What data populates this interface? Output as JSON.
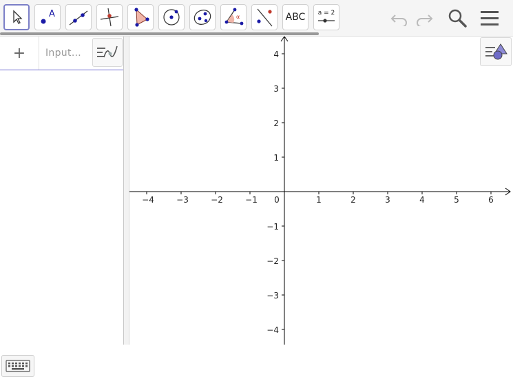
{
  "toolbar": {
    "tools": [
      {
        "name": "move-tool",
        "selected": true
      },
      {
        "name": "point-tool",
        "glyph": "A"
      },
      {
        "name": "line-tool"
      },
      {
        "name": "perpendicular-line-tool"
      },
      {
        "name": "polygon-tool"
      },
      {
        "name": "circle-center-point-tool"
      },
      {
        "name": "conic-tool"
      },
      {
        "name": "angle-tool",
        "glyph": "α"
      },
      {
        "name": "reflect-tool"
      },
      {
        "name": "text-tool",
        "label": "ABC"
      },
      {
        "name": "slider-tool",
        "label": "a = 2"
      }
    ],
    "actions": [
      "undo-icon",
      "redo-icon",
      "search-icon",
      "menu-icon"
    ]
  },
  "algebra": {
    "add_label": "+",
    "input_placeholder": "Input…"
  },
  "graphics": {
    "x_axis": {
      "min": -4,
      "max": 6,
      "ticks": [
        "−4",
        "−3",
        "−2",
        "−1",
        "0",
        "1",
        "2",
        "3",
        "4",
        "5",
        "6"
      ]
    },
    "y_axis": {
      "min": -4,
      "max": 4,
      "ticks_pos": [
        "4",
        "3",
        "2",
        "1"
      ],
      "ticks_neg": [
        "−1",
        "−2",
        "−3",
        "−4"
      ]
    }
  },
  "colors": {
    "accent": "#6d6ad0",
    "point": "#1a1aa6",
    "polygon_fill": "#f0b5a8"
  }
}
